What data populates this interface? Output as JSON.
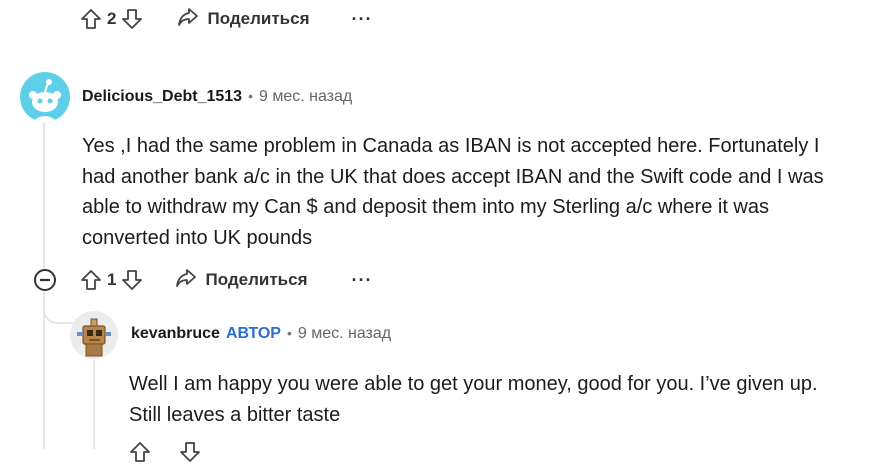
{
  "top_actions": {
    "vote_count": "2",
    "share_label": "Поделиться",
    "more_label": "···"
  },
  "comment1": {
    "author": "Delicious_Debt_1513",
    "dot": "•",
    "time": "9 мес. назад",
    "lines": [
      "Yes ,I had the same problem in Canada as IBAN is not accepted here. Fortunately I",
      "had another bank a/c in the UK that does accept IBAN and the Swift code and I was",
      "able to withdraw my Can $ and deposit them into my Sterling a/c where it was",
      "converted into UK pounds"
    ],
    "vote_count": "1",
    "share_label": "Поделиться",
    "more_label": "···"
  },
  "comment2": {
    "author": "kevanbruce",
    "op_badge": "АВТОР",
    "dot": "•",
    "time": "9 мес. назад",
    "lines": [
      "Well I am happy you were able to get your money, good for you. I’ve given up.",
      "Still leaves a bitter taste"
    ]
  },
  "colors": {
    "avatar1": "#5ecfe8",
    "op_badge": "#2a6fd1",
    "thread_line": "#e6e6e6"
  }
}
